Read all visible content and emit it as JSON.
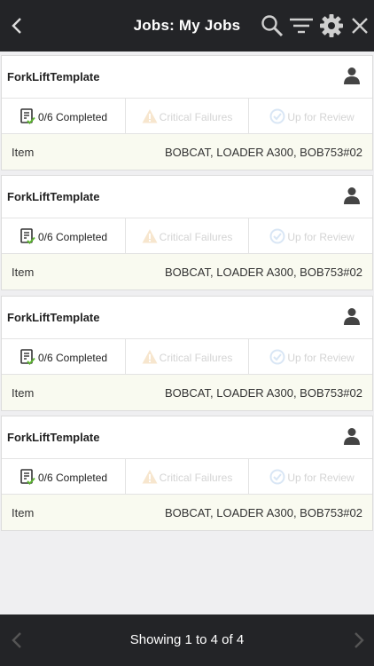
{
  "header": {
    "title": "Jobs: My Jobs",
    "icons": [
      "back-chevron-icon",
      "search-icon",
      "filter-icon",
      "gear-icon",
      "close-icon"
    ]
  },
  "jobs": [
    {
      "name": "ForkLiftTemplate",
      "completed": "0/6 Completed",
      "critical": "Critical Failures",
      "review": "Up for Review",
      "item_label": "Item",
      "item_value": "BOBCAT, LOADER A300, BOB753#02"
    },
    {
      "name": "ForkLiftTemplate",
      "completed": "0/6 Completed",
      "critical": "Critical Failures",
      "review": "Up for Review",
      "item_label": "Item",
      "item_value": "BOBCAT, LOADER A300, BOB753#02"
    },
    {
      "name": "ForkLiftTemplate",
      "completed": "0/6 Completed",
      "critical": "Critical Failures",
      "review": "Up for Review",
      "item_label": "Item",
      "item_value": "BOBCAT, LOADER A300, BOB753#02"
    },
    {
      "name": "ForkLiftTemplate",
      "completed": "0/6 Completed",
      "critical": "Critical Failures",
      "review": "Up for Review",
      "item_label": "Item",
      "item_value": "BOBCAT, LOADER A300, BOB753#02"
    }
  ],
  "footer": {
    "pagination_text": "Showing 1 to 4 of 4"
  },
  "colors": {
    "bar_background": "#232427",
    "page_background": "#efeff1",
    "item_row_background": "#f9faf0",
    "check_green": "#5cb531"
  }
}
